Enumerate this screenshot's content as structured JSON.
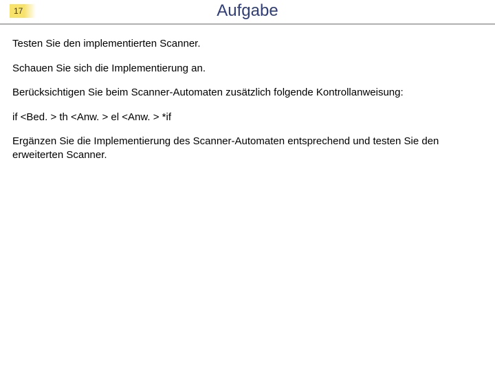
{
  "page_number": "17",
  "title": "Aufgabe",
  "paragraphs": [
    "Testen Sie den implementierten Scanner.",
    "Schauen Sie sich die Implementierung an.",
    "Berücksichtigen Sie beim Scanner-Automaten zusätzlich folgende Kontrollanweisung:",
    "if <Bed. > th <Anw. > el <Anw. > *if",
    "Ergänzen Sie die Implementierung des Scanner-Automaten entsprechend und testen Sie den erweiterten Scanner."
  ]
}
